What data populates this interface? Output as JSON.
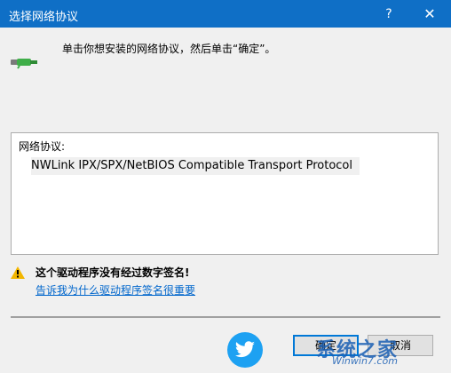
{
  "window": {
    "title": "选择网络协议",
    "help_label": "?",
    "close_label": "✕"
  },
  "instruction": "单击你想安装的网络协议，然后单击“确定”。",
  "protocol_list": {
    "header": "网络协议:",
    "items": [
      "NWLink IPX/SPX/NetBIOS Compatible Transport Protocol"
    ]
  },
  "warning": {
    "text": "这个驱动程序没有经过数字签名!",
    "link": "告诉我为什么驱动程序签名很重要"
  },
  "buttons": {
    "ok": "确定",
    "cancel": "取消"
  },
  "watermark": {
    "text": "系统之家",
    "url": "Winwin7.com"
  },
  "colors": {
    "titlebar": "#0f6fc6",
    "link": "#0066cc",
    "warning_icon": "#f2b600"
  }
}
